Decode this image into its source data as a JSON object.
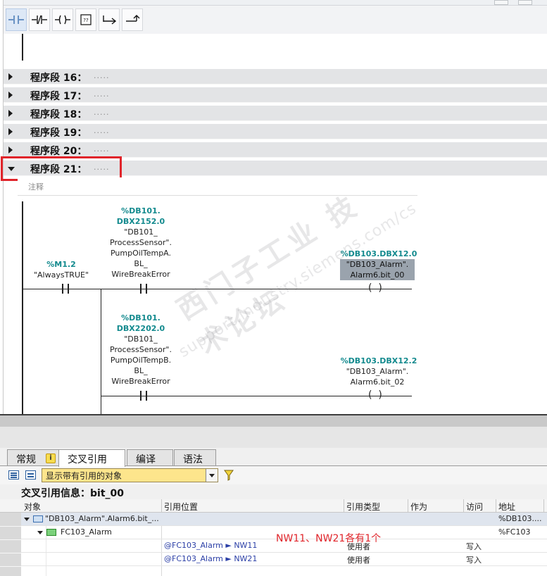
{
  "toolbar": {
    "buttons": [
      {
        "name": "no-contact-button",
        "icon": "normally-open-contact-icon"
      },
      {
        "name": "nc-contact-button",
        "icon": "normally-closed-contact-icon"
      },
      {
        "name": "coil-button",
        "icon": "coil-icon"
      },
      {
        "name": "empty-box-button",
        "icon": "empty-box-icon",
        "label": "??"
      },
      {
        "name": "open-branch-button",
        "icon": "open-branch-icon"
      },
      {
        "name": "close-branch-button",
        "icon": "close-branch-icon"
      }
    ]
  },
  "networks": [
    {
      "title": "程序段 16：",
      "dots": ".....",
      "expanded": false
    },
    {
      "title": "程序段 17：",
      "dots": ".....",
      "expanded": false
    },
    {
      "title": "程序段 18：",
      "dots": ".....",
      "expanded": false
    },
    {
      "title": "程序段 19：",
      "dots": ".....",
      "expanded": false
    },
    {
      "title": "程序段 20：",
      "dots": ".....",
      "expanded": false
    },
    {
      "title": "程序段 21：",
      "dots": ".....",
      "expanded": true
    }
  ],
  "network21": {
    "comment_placeholder": "注释",
    "m12": {
      "addr": "%M1.2",
      "name": "\"AlwaysTRUE\""
    },
    "contact1": {
      "addr1": "%DB101.",
      "addr2": "DBX2152.0",
      "n1": "\"DB101_",
      "n2": "ProcessSensor\".",
      "n3": "PumpOilTempA.",
      "n4": "BL_",
      "n5": "WireBreakError"
    },
    "coil1": {
      "addr": "%DB103.DBX12.0",
      "n1": "\"DB103_Alarm\".",
      "n2": "Alarm6.bit_00"
    },
    "contact2": {
      "addr1": "%DB101.",
      "addr2": "DBX2202.0",
      "n1": "\"DB101_",
      "n2": "ProcessSensor\".",
      "n3": "PumpOilTempB.",
      "n4": "BL_",
      "n5": "WireBreakError"
    },
    "coil2": {
      "addr": "%DB103.DBX12.2",
      "n1": "\"DB103_Alarm\".",
      "n2": "Alarm6.bit_02"
    }
  },
  "watermark": {
    "line1": "西门子工业  技术论坛",
    "line2": "support.industry.siemens.com/cs"
  },
  "bottom": {
    "tabs": [
      "常规",
      "交叉引用",
      "编译",
      "语法"
    ],
    "filter_value": "显示带有引用的对象",
    "info_title": "交叉引用信息：bit_00",
    "columns": [
      "对象",
      "引用位置",
      "引用类型",
      "作为",
      "访问",
      "地址"
    ],
    "rows": [
      {
        "object": "\"DB103_Alarm\".Alarm6.bit_...",
        "location": "",
        "type": "",
        "as": "",
        "access": "",
        "address": "%DB103...."
      },
      {
        "object": "FC103_Alarm",
        "location": "",
        "type": "",
        "as": "",
        "access": "",
        "address": "%FC103"
      },
      {
        "object": "",
        "location": "@FC103_Alarm ► NW11",
        "type": "使用者",
        "as": "",
        "access": "写入",
        "address": ""
      },
      {
        "object": "",
        "location": "@FC103_Alarm ► NW21",
        "type": "使用者",
        "as": "",
        "access": "写入",
        "address": ""
      }
    ],
    "annotation": "NW11、NW21各有1个"
  }
}
